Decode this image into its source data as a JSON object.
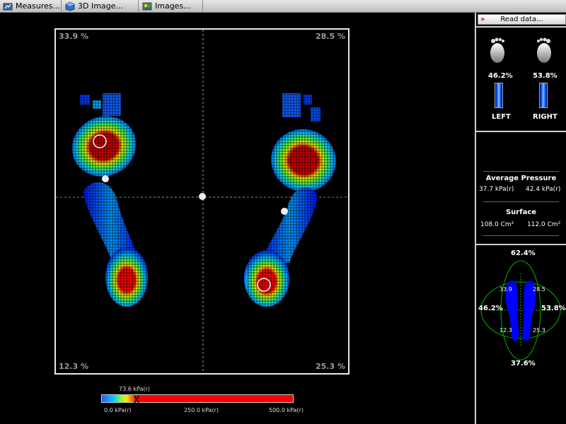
{
  "tabs": [
    {
      "label": "Measures...",
      "icon": "measures-icon"
    },
    {
      "label": "3D Image...",
      "icon": "cube-icon"
    },
    {
      "label": "Images...",
      "icon": "images-icon"
    }
  ],
  "plot": {
    "corners": {
      "top_left": "33.9 %",
      "top_right": "28.5 %",
      "bottom_left": "12.3 %",
      "bottom_right": "25.3 %"
    }
  },
  "scale": {
    "marker_value": "73.6 kPa(r)",
    "min": "0.0 kPa(r)",
    "mid": "250.0 kPa(r)",
    "max": "500.0 kPa(r)"
  },
  "panel": {
    "read_button": "Read data...",
    "left": {
      "pct": "46.2%",
      "label": "LEFT",
      "fill": 0.462
    },
    "right": {
      "pct": "53.8%",
      "label": "RIGHT",
      "fill": 0.538
    },
    "avg_pressure_title": "Average Pressure",
    "avg_left": "37.7 kPa(r)",
    "avg_right": "42.4 kPa(r)",
    "surface_title": "Surface",
    "surface_left": "108.0 Cm²",
    "surface_right": "112.0 Cm²",
    "balance": {
      "front": "62.4%",
      "back": "37.6%",
      "left": "46.2%",
      "right": "53.8%",
      "q_tl": "33.9",
      "q_tr": "28.5",
      "q_bl": "12.3",
      "q_br": "25.3"
    }
  },
  "colors": {
    "accent_red": "#ff0000",
    "grid_green": "#00c000",
    "foot_blue": "#0000ff"
  }
}
